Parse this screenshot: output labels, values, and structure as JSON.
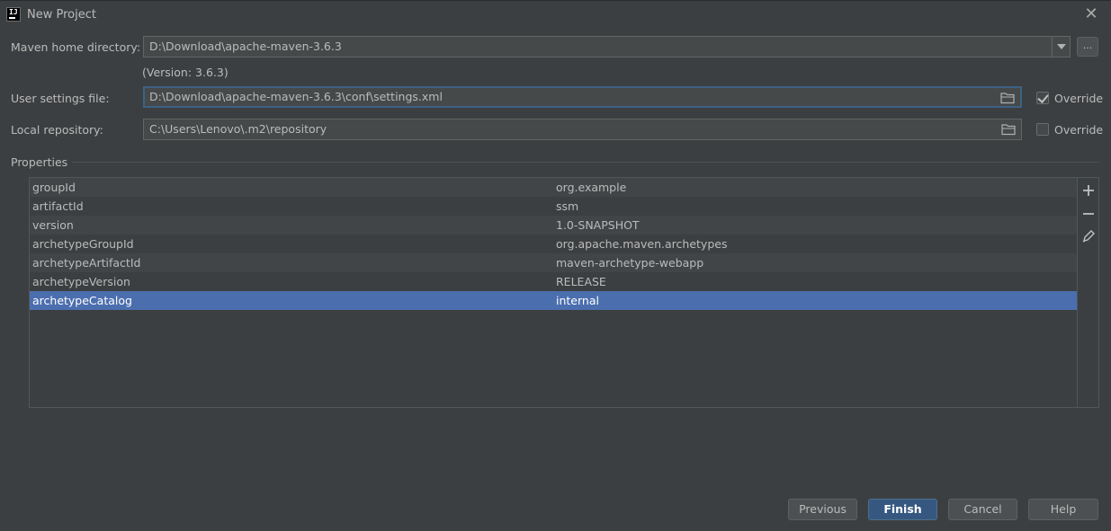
{
  "window": {
    "title": "New Project"
  },
  "maven_home": {
    "label": "Maven home directory:",
    "value": "D:\\Download\\apache-maven-3.6.3",
    "browse_label": "..."
  },
  "version_text": "(Version: 3.6.3)",
  "user_settings": {
    "label": "User settings file:",
    "value": "D:\\Download\\apache-maven-3.6.3\\conf\\settings.xml",
    "override_label": "Override",
    "override_checked": true
  },
  "local_repo": {
    "label": "Local repository:",
    "value": "C:\\Users\\Lenovo\\.m2\\repository",
    "override_label": "Override",
    "override_checked": false
  },
  "properties": {
    "title": "Properties",
    "rows": [
      {
        "key": "groupId",
        "value": "org.example"
      },
      {
        "key": "artifactId",
        "value": "ssm"
      },
      {
        "key": "version",
        "value": "1.0-SNAPSHOT"
      },
      {
        "key": "archetypeGroupId",
        "value": "org.apache.maven.archetypes"
      },
      {
        "key": "archetypeArtifactId",
        "value": "maven-archetype-webapp"
      },
      {
        "key": "archetypeVersion",
        "value": "RELEASE"
      },
      {
        "key": "archetypeCatalog",
        "value": "internal"
      }
    ],
    "selected_index": 6
  },
  "buttons": {
    "previous": "Previous",
    "finish": "Finish",
    "cancel": "Cancel",
    "help": "Help"
  },
  "colors": {
    "background": "#3c3f41",
    "selection": "#4b6eaf",
    "default_button": "#365880",
    "focus_border": "#3d6185"
  }
}
